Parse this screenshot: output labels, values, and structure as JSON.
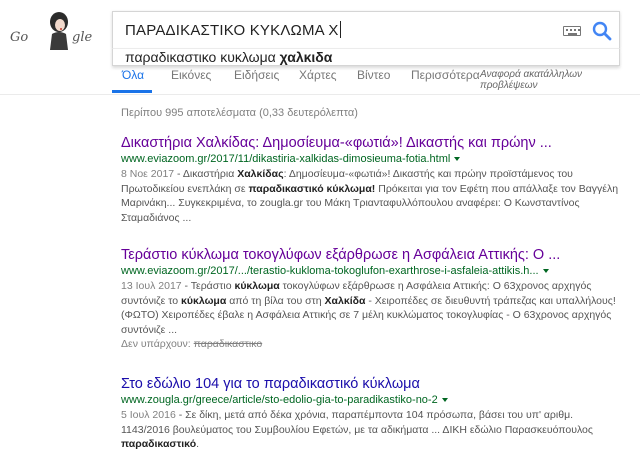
{
  "logo": {
    "left_text": "Go",
    "right_text": "gle"
  },
  "search": {
    "query": "ΠΑΡΑΔΙΚΑΣΤΙΚΟ ΚΥΚΛΩΜΑ Χ",
    "suggestion_prefix": "παραδικαστικο κυκλωμα ",
    "suggestion_bold": "χαλκιδα"
  },
  "tabs": [
    {
      "label": "Όλα",
      "active": true
    },
    {
      "label": "Εικόνες"
    },
    {
      "label": "Ειδήσεις"
    },
    {
      "label": "Χάρτες"
    },
    {
      "label": "Βίντεο"
    },
    {
      "label": "Περισσότερα"
    }
  ],
  "report_link": "Αναφορά ακατάλληλων προβλέψεων",
  "stats": "Περίπου 995 αποτελέσματα (0,33 δευτερόλεπτα)",
  "results": [
    {
      "title": "Δικαστήρια Χαλκίδας: Δημοσίευμα-«φωτιά»! Δικαστής και πρώην ...",
      "url": "www.eviazoom.gr/2017/11/dikastiria-xalkidas-dimosieuma-fotia.html",
      "date": "8 Νοε 2017",
      "snippet": [
        {
          "t": " - Δικαστήρια "
        },
        {
          "b": "Χαλκίδας"
        },
        {
          "t": ": Δημοσίευμα-«φωτιά»! Δικαστής και πρώην προϊστάμενος του Πρωτοδικείου ενεπλάκη σε "
        },
        {
          "b": "παραδικαστικό κύκλωμα!"
        },
        {
          "t": " Πρόκειται για τον Εφέτη που απάλλαξε τον Βαγγέλη Μαρινάκη... Συγκεκριμένα, το zougla.gr του Μάκη Τριανταφυλλόπουλου αναφέρει: Ο Κωνσταντίνος Σταμαδιάνος ..."
        }
      ]
    },
    {
      "title": "Τεράστιο κύκλωμα τοκογλύφων εξάρθρωσε η Ασφάλεια Αττικής: Ο ...",
      "url": "www.eviazoom.gr/2017/.../terastio-kukloma-tokoglufon-exarthrose-i-asfaleia-attikis.h...",
      "date": "13 Ιουλ 2017",
      "snippet": [
        {
          "t": " - Τεράστιο "
        },
        {
          "b": "κύκλωμα"
        },
        {
          "t": " τοκογλύφων εξάρθρωσε η Ασφάλεια Αττικής: Ο 63χρονος αρχηγός συντόνιζε το "
        },
        {
          "b": "κύκλωμα"
        },
        {
          "t": " από τη βίλα του στη "
        },
        {
          "b": "Χαλκίδα"
        },
        {
          "t": " - Χειροπέδες σε διευθυντή τράπεζας και υπαλλήλους! (ΦΩΤΟ) Χειροπέδες έβαλε η Ασφάλεια Αττικής σε 7 μέλη κυκλώματος τοκογλυφίας - Ο 63χρονος αρχηγός συντόνιζε ..."
        }
      ],
      "missing_label": "Δεν υπάρχουν:",
      "missing_term": "παραδικαστικο"
    },
    {
      "title": "Στο εδώλιο 104 για το παραδικαστικό κύκλωμα",
      "url": "www.zougla.gr/greece/article/sto-edolio-gia-to-paradikastiko-no-2",
      "date": "5 Ιουλ 2016",
      "snippet": [
        {
          "t": " - Σε δίκη, μετά από δέκα χρόνια, παραπέμποντα 104 πρόσωπα, βάσει του υπ' αριθμ. 1143/2016 βουλεύματος του Συμβουλίου Εφετών, με τα αδικήματα ... ΔΙΚΗ εδώλιο Παρασκευόπουλος "
        },
        {
          "b": "παραδικαστικό"
        },
        {
          "t": "."
        }
      ]
    }
  ],
  "colors": {
    "link": "#1a0dab",
    "visited": "#660099",
    "url": "#006621",
    "accent": "#1a73e8"
  }
}
